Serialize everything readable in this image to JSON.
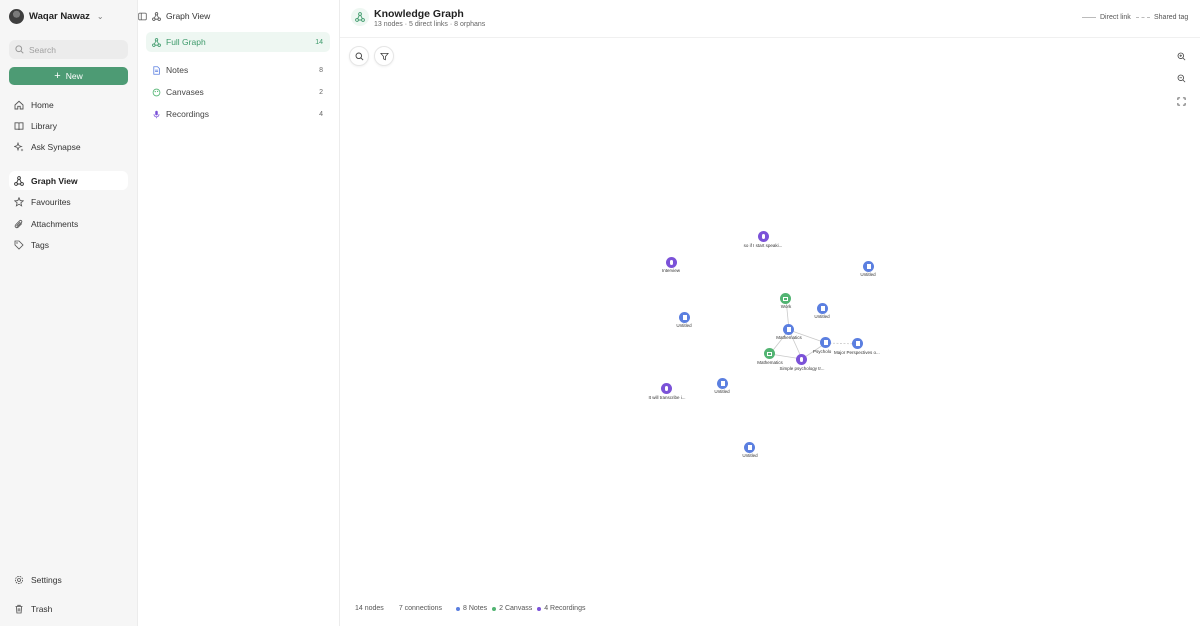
{
  "user": {
    "name": "Waqar Nawaz"
  },
  "search": {
    "placeholder": "Search"
  },
  "new_button": {
    "label": "New"
  },
  "nav": {
    "home": "Home",
    "library": "Library",
    "ask_synapse": "Ask Synapse",
    "graph_view": "Graph View",
    "favourites": "Favourites",
    "attachments": "Attachments",
    "tags": "Tags",
    "settings": "Settings",
    "trash": "Trash"
  },
  "graph_panel": {
    "title": "Graph View",
    "items": [
      {
        "label": "Full Graph",
        "count": "14"
      },
      {
        "label": "Notes",
        "count": "8"
      },
      {
        "label": "Canvases",
        "count": "2"
      },
      {
        "label": "Recordings",
        "count": "4"
      }
    ]
  },
  "header": {
    "title": "Knowledge Graph",
    "subtitle": "13 nodes · 5 direct links · 8 orphans",
    "legend_direct": "Direct link",
    "legend_shared": "Shared tag"
  },
  "graph": {
    "nodes": [
      {
        "label": "so if I start speaki...",
        "kind": "rec"
      },
      {
        "label": "Interview",
        "kind": "rec"
      },
      {
        "label": "Untitled",
        "kind": "note"
      },
      {
        "label": "Work",
        "kind": "canvas"
      },
      {
        "label": "Untitled",
        "kind": "note"
      },
      {
        "label": "Untitled",
        "kind": "note"
      },
      {
        "label": "Mathematics",
        "kind": "note"
      },
      {
        "label": "Psycholo",
        "kind": "note"
      },
      {
        "label": "Major Perspectives o...",
        "kind": "note"
      },
      {
        "label": "Mathematics",
        "kind": "canvas"
      },
      {
        "label": "Simple psychology tr...",
        "kind": "rec"
      },
      {
        "label": "It will transcribe i...",
        "kind": "rec"
      },
      {
        "label": "Untitled",
        "kind": "note"
      },
      {
        "label": "Untitled",
        "kind": "note"
      }
    ]
  },
  "footer": {
    "nodes": "14 nodes",
    "connections": "7 connections",
    "notes": "8 Notes",
    "canvas": "2 Canvass",
    "recordings": "4 Recordings"
  },
  "colors": {
    "accent": "#4d9b74",
    "note": "#5b7fe0",
    "canvas": "#52b472",
    "recording": "#7b52d8"
  }
}
